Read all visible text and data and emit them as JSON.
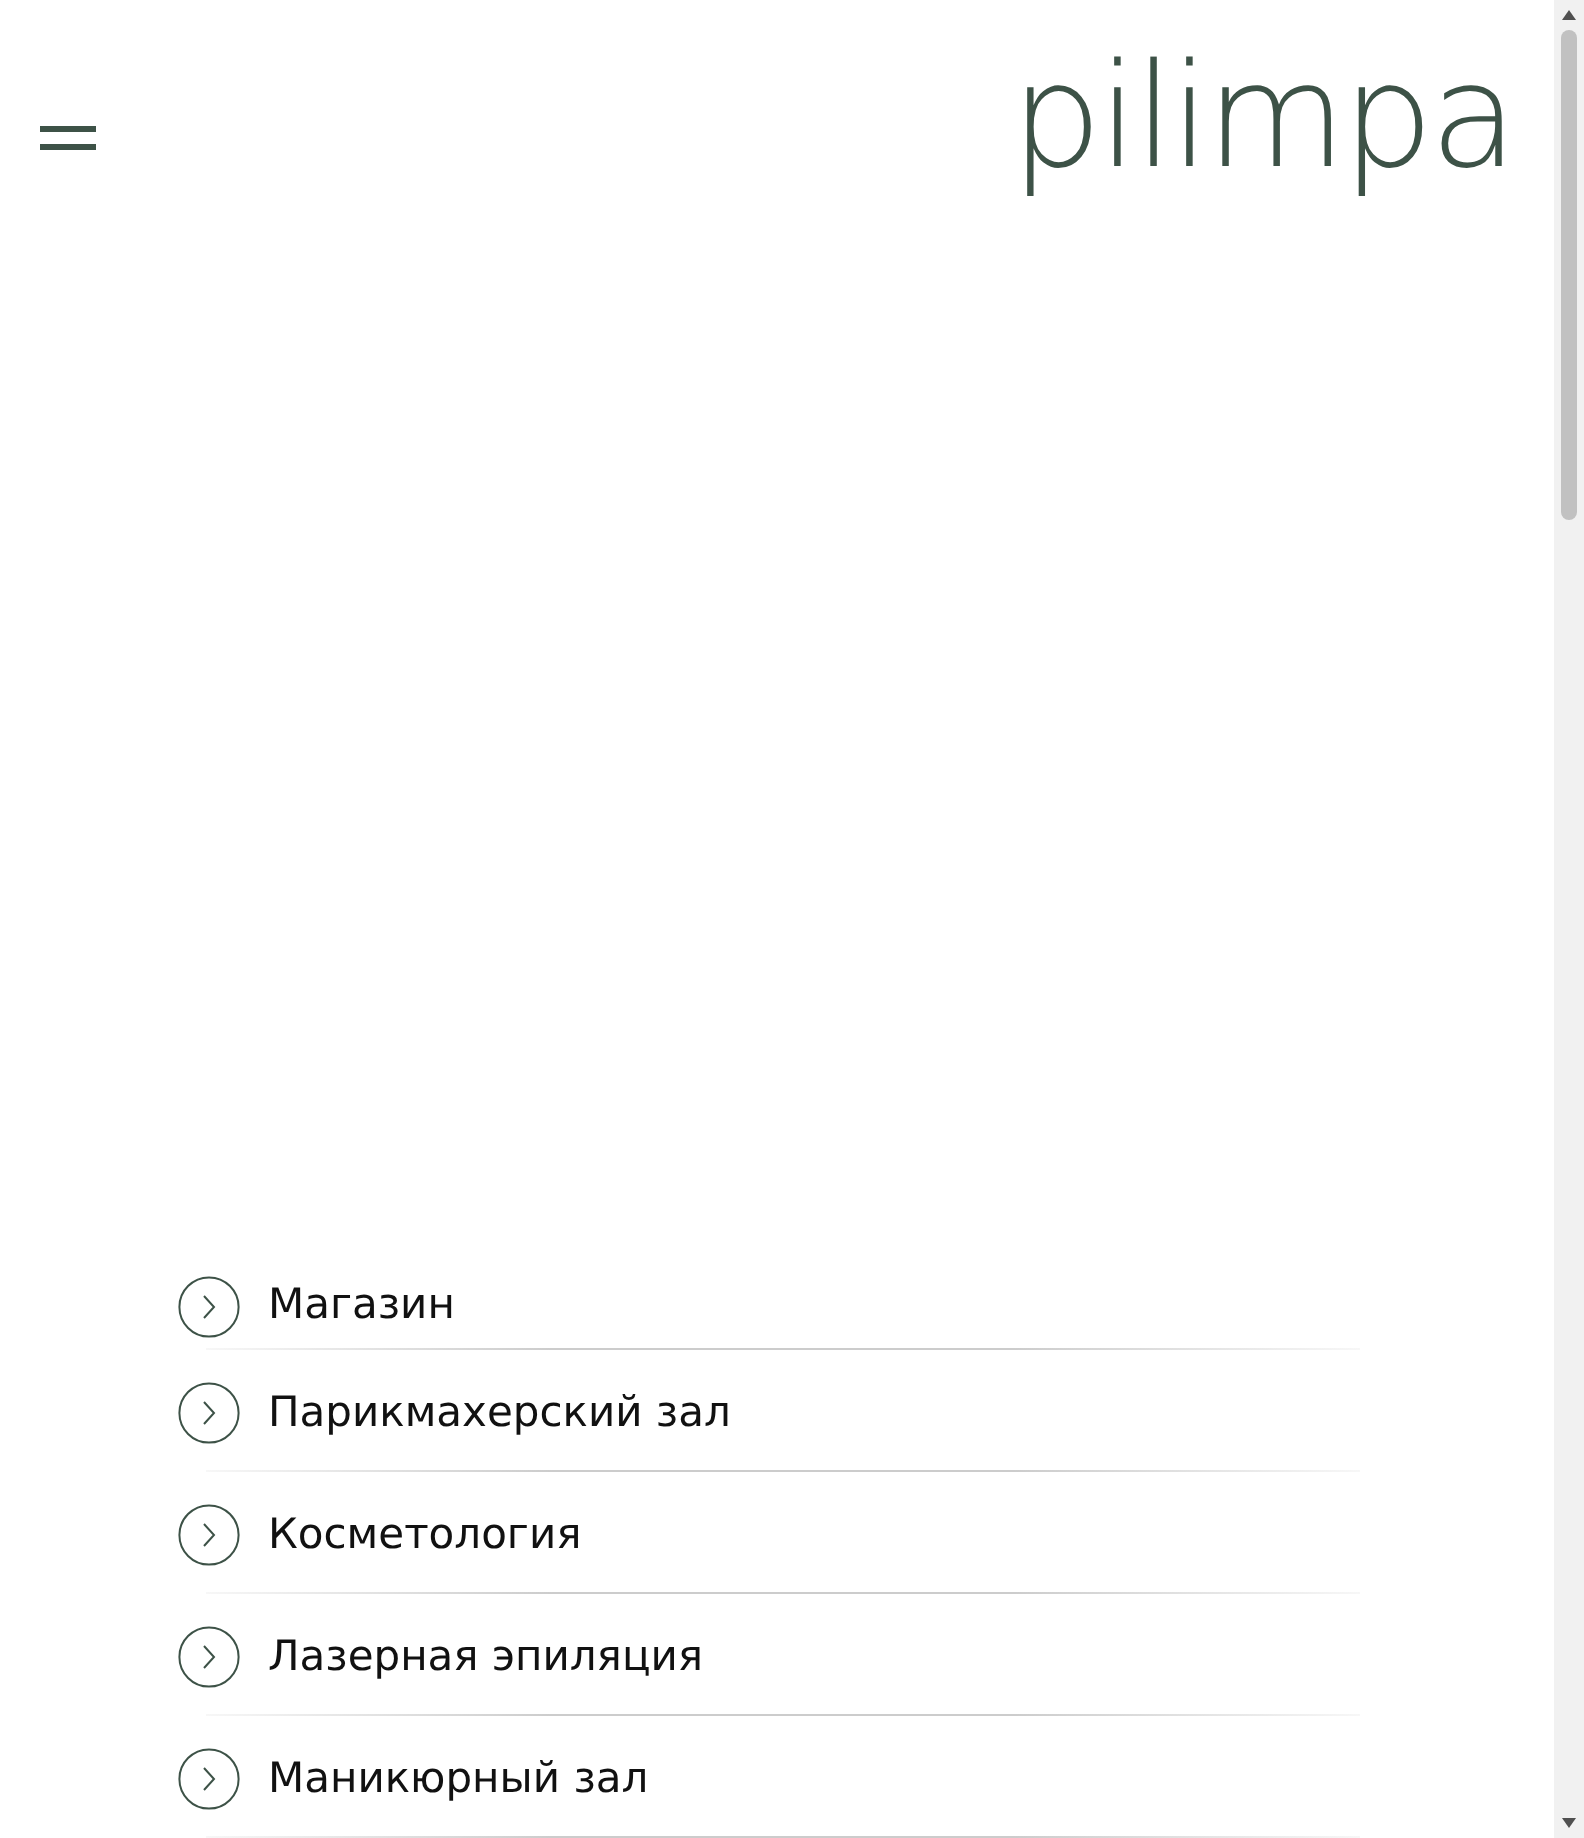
{
  "header": {
    "logo": "pilimpa"
  },
  "menu": [
    {
      "label": "Магазин"
    },
    {
      "label": "Парикмахерский зал"
    },
    {
      "label": "Косметология"
    },
    {
      "label": "Лазерная эпиляция"
    },
    {
      "label": "Маникюрный зал"
    }
  ]
}
